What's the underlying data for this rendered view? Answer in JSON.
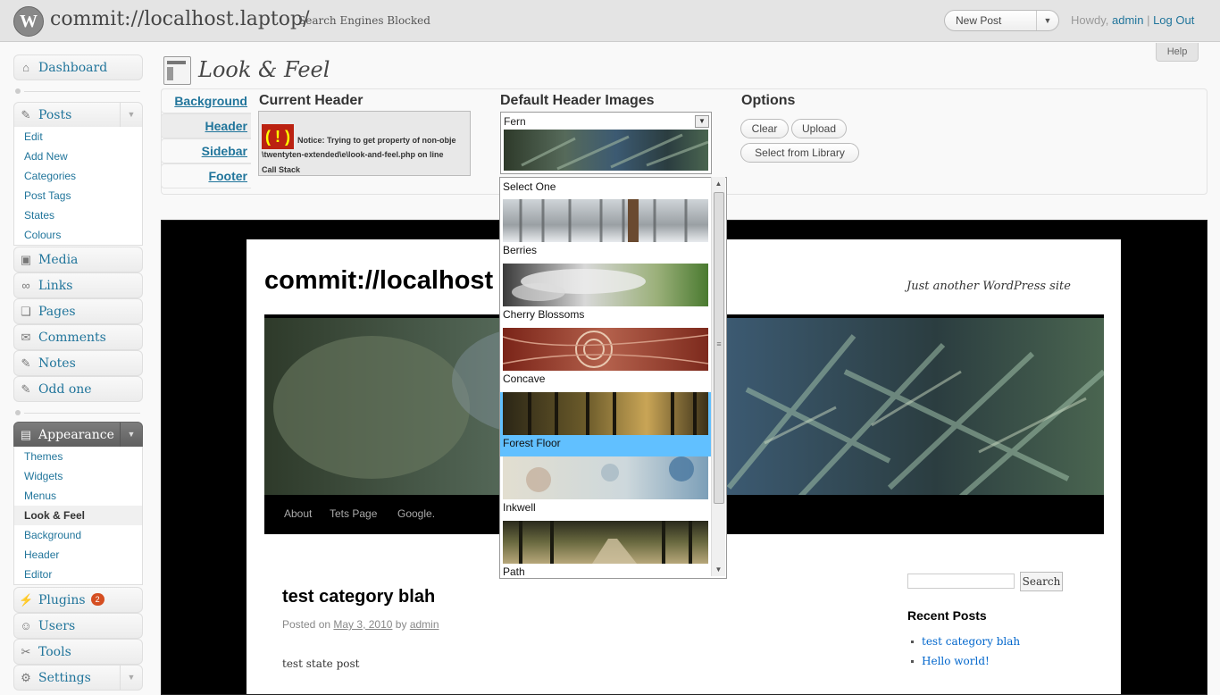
{
  "header": {
    "site_title": "commit://localhost.laptop/",
    "site_notice": "Search Engines Blocked",
    "favorite_action": "New Post",
    "howdy": "Howdy,",
    "user": "admin",
    "separator": "|",
    "logout": "Log Out",
    "help": "Help"
  },
  "menu": {
    "dashboard": "Dashboard",
    "posts": "Posts",
    "posts_sub": [
      "Edit",
      "Add New",
      "Categories",
      "Post Tags",
      "States",
      "Colours"
    ],
    "media": "Media",
    "links": "Links",
    "pages": "Pages",
    "comments": "Comments",
    "notes": "Notes",
    "odd_one": "Odd one",
    "appearance": "Appearance",
    "appearance_sub": [
      "Themes",
      "Widgets",
      "Menus",
      "Look & Feel",
      "Background",
      "Header",
      "Editor"
    ],
    "plugins": "Plugins",
    "plugins_count": "2",
    "users": "Users",
    "tools": "Tools",
    "settings": "Settings"
  },
  "page": {
    "title": "Look & Feel",
    "tabs": [
      "Background",
      "Header",
      "Sidebar",
      "Footer"
    ],
    "active_tab": "Header",
    "current_header_heading": "Current Header",
    "error_notice": "Notice: Trying to get property of non-obje",
    "error_path": "\\twentyten-extended\\e\\look-and-feel.php on line",
    "error_callstack": "Call Stack",
    "error_icon": "( ! )",
    "default_images_heading": "Default Header Images",
    "selected_image": "Fern",
    "options_heading": "Options",
    "btn_clear": "Clear",
    "btn_upload": "Upload",
    "btn_library": "Select from Library"
  },
  "dropdown": {
    "options": [
      {
        "label": "Select One",
        "thumb": "none"
      },
      {
        "label": "Berries",
        "thumb": "berries"
      },
      {
        "label": "Cherry Blossoms",
        "thumb": "cherry"
      },
      {
        "label": "Concave",
        "thumb": "concave"
      },
      {
        "label": "Forest Floor",
        "thumb": "forest"
      },
      {
        "label": "Inkwell",
        "thumb": "inkwell"
      },
      {
        "label": "Path",
        "thumb": "path"
      }
    ],
    "highlighted": "Forest Floor"
  },
  "preview": {
    "site_title": "commit://localhost",
    "tagline": "Just another WordPress site",
    "nav": [
      "About",
      "Tets Page",
      "Google."
    ],
    "post_title": "test category blah",
    "posted_on": "Posted on",
    "post_date": "May 3, 2010",
    "by": "by",
    "author": "admin",
    "entry": "test state post",
    "search_button": "Search",
    "recent_posts_heading": "Recent Posts",
    "recent_posts": [
      "test category blah",
      "Hello world!"
    ]
  },
  "colors": {
    "link": "#21759b",
    "highlight": "#61c0ff",
    "badge": "#d54e21",
    "appearance_active": "#6d6d6d"
  }
}
